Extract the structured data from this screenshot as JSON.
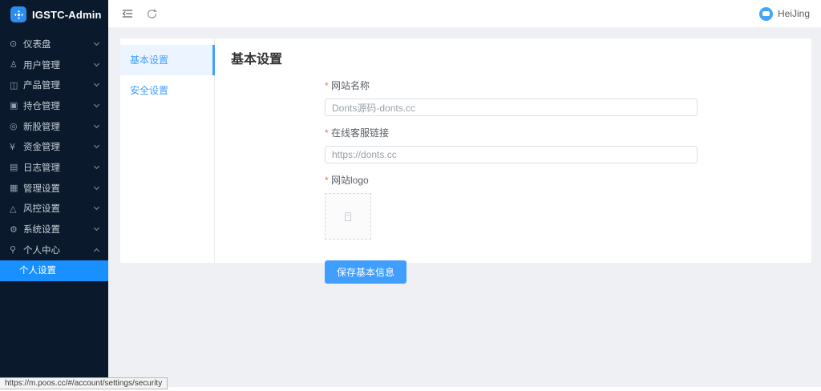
{
  "app": {
    "title": "IGSTC-Admin"
  },
  "topbar": {
    "username": "HeiJing"
  },
  "sidebar": {
    "items": [
      {
        "label": "仪表盘",
        "icon": "dashboard"
      },
      {
        "label": "用户管理",
        "icon": "users"
      },
      {
        "label": "产品管理",
        "icon": "products"
      },
      {
        "label": "持仓管理",
        "icon": "positions"
      },
      {
        "label": "新股管理",
        "icon": "ipo"
      },
      {
        "label": "资金管理",
        "icon": "funds"
      },
      {
        "label": "日志管理",
        "icon": "logs"
      },
      {
        "label": "管理设置",
        "icon": "admin-settings"
      },
      {
        "label": "风控设置",
        "icon": "risk"
      },
      {
        "label": "系统设置",
        "icon": "system-settings"
      },
      {
        "label": "个人中心",
        "icon": "profile",
        "expanded": true
      }
    ],
    "active_submenu": {
      "label": "个人设置"
    }
  },
  "icons": {
    "dashboard": "⊙",
    "users": "♙",
    "products": "◫",
    "positions": "▣",
    "ipo": "◎",
    "funds": "¥",
    "logs": "▤",
    "admin_settings": "▦",
    "risk": "△",
    "system_settings": "⚙",
    "profile": "⚲"
  },
  "settings_nav": [
    {
      "label": "基本设置",
      "active": true
    },
    {
      "label": "安全设置",
      "active": false
    }
  ],
  "main": {
    "heading": "基本设置",
    "form": {
      "fields": [
        {
          "label": "网站名称",
          "value": "Donts源码-donts.cc"
        },
        {
          "label": "在线客服链接",
          "value": "https://donts.cc"
        },
        {
          "label": "网站logo",
          "value": ""
        }
      ],
      "submit_label": "保存基本信息"
    }
  },
  "statusbar": {
    "url": "https://m.poos.cc/#/account/settings/security"
  },
  "colors": {
    "accent": "#409eff",
    "active_submenu": "#1890ff",
    "sidebar_bg": "#0a1a2c",
    "page_bg": "#eef0f4",
    "required_red": "#f56c6c"
  }
}
